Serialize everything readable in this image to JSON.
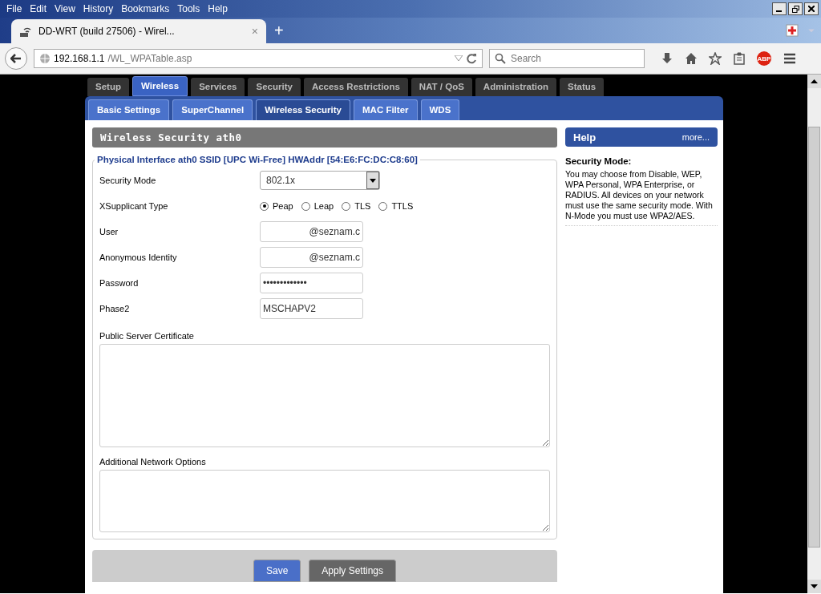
{
  "browser": {
    "menu": [
      "File",
      "Edit",
      "View",
      "History",
      "Bookmarks",
      "Tools",
      "Help"
    ],
    "tab": {
      "title": "DD-WRT (build 27506) - Wirel...",
      "close": "×"
    },
    "new_tab": "+",
    "url": {
      "host": "192.168.1.1",
      "path": "/WL_WPATable.asp"
    },
    "search": {
      "placeholder": "Search"
    },
    "adblock": "ABP"
  },
  "main_tabs": [
    {
      "label": "Setup",
      "selected": false
    },
    {
      "label": "Wireless",
      "selected": true
    },
    {
      "label": "Services",
      "selected": false
    },
    {
      "label": "Security",
      "selected": false
    },
    {
      "label": "Access Restrictions",
      "selected": false
    },
    {
      "label": "NAT / QoS",
      "selected": false
    },
    {
      "label": "Administration",
      "selected": false
    },
    {
      "label": "Status",
      "selected": false
    }
  ],
  "sub_tabs": [
    {
      "label": "Basic Settings",
      "selected": false
    },
    {
      "label": "SuperChannel",
      "selected": false
    },
    {
      "label": "Wireless Security",
      "selected": true
    },
    {
      "label": "MAC Filter",
      "selected": false
    },
    {
      "label": "WDS",
      "selected": false
    }
  ],
  "section": {
    "title": "Wireless Security ath0",
    "legend": "Physical Interface ath0 SSID [UPC Wi-Free] HWAddr [54:E6:FC:DC:C8:60]"
  },
  "fields": [
    {
      "kind": "select",
      "label": "Security Mode",
      "value": "802.1x"
    },
    {
      "kind": "radio",
      "label": "XSupplicant Type",
      "options": [
        {
          "label": "Peap",
          "selected": true
        },
        {
          "label": "Leap",
          "selected": false
        },
        {
          "label": "TLS",
          "selected": false
        },
        {
          "label": "TTLS",
          "selected": false
        }
      ]
    },
    {
      "kind": "text",
      "label": "User",
      "value": "@seznam.c"
    },
    {
      "kind": "text",
      "label": "Anonymous Identity",
      "value": "@seznam.c"
    },
    {
      "kind": "password",
      "label": "Password",
      "value": "•••••••••••••"
    },
    {
      "kind": "plain",
      "label": "Phase2",
      "value": "MSCHAPV2"
    }
  ],
  "textareas": [
    {
      "label": "Public Server Certificate"
    },
    {
      "label": "Additional Network Options"
    }
  ],
  "help": {
    "title": "Help",
    "more": "more...",
    "heading": "Security Mode:",
    "text": "You may choose from Disable, WEP, WPA Personal, WPA Enterprise, or RADIUS. All devices on your network must use the same security mode. With N-Mode you must use WPA2/AES."
  },
  "buttons": [
    {
      "label": "Save",
      "kind": "primary"
    },
    {
      "label": "Apply Settings",
      "kind": "secondary"
    }
  ]
}
